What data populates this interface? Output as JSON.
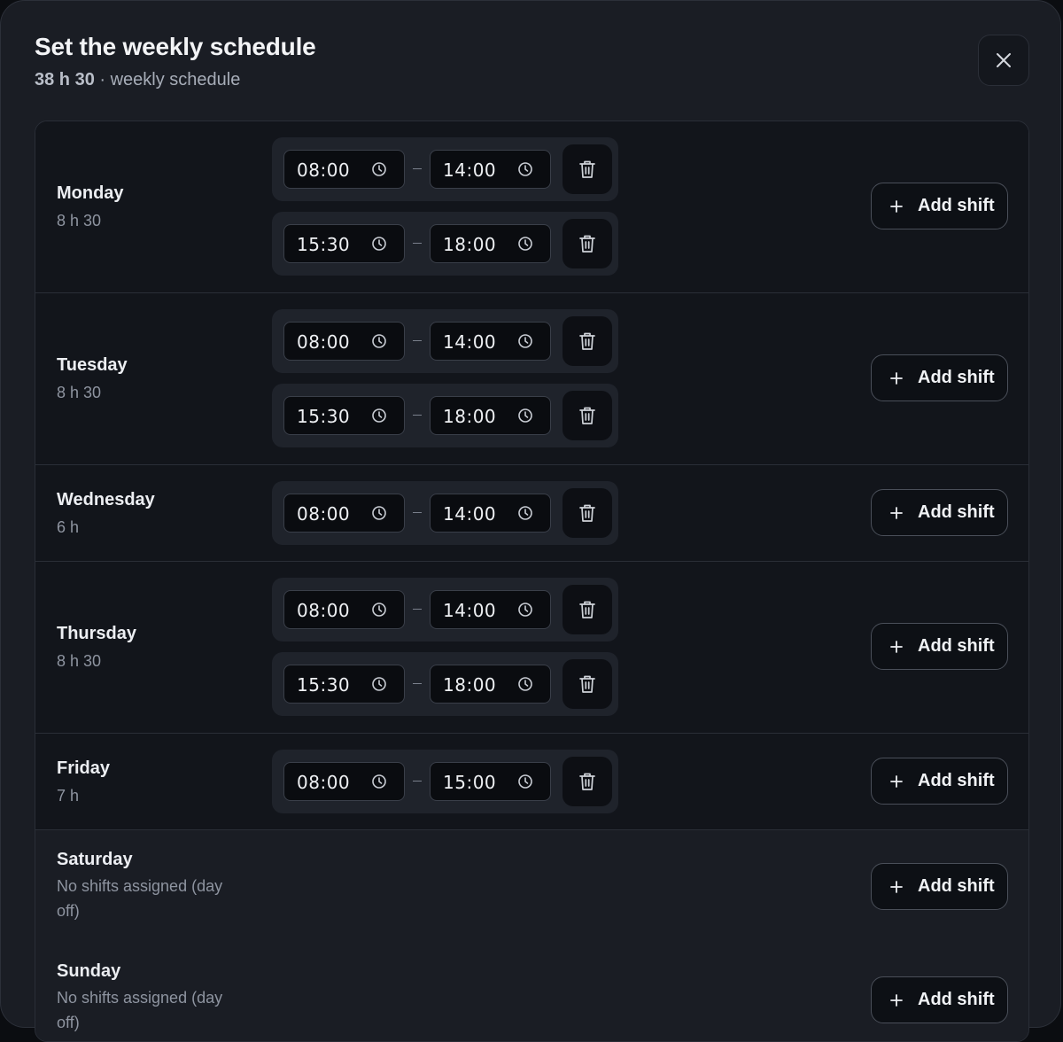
{
  "header": {
    "title": "Set the weekly schedule",
    "total": "38 h 30",
    "subtitle_rest": " · weekly schedule"
  },
  "add_label": "Add shift",
  "days": [
    {
      "name": "Monday",
      "total": "8 h 30",
      "shifts": [
        {
          "start": "08:00",
          "end": "14:00"
        },
        {
          "start": "15:30",
          "end": "18:00"
        }
      ]
    },
    {
      "name": "Tuesday",
      "total": "8 h 30",
      "shifts": [
        {
          "start": "08:00",
          "end": "14:00"
        },
        {
          "start": "15:30",
          "end": "18:00"
        }
      ]
    },
    {
      "name": "Wednesday",
      "total": "6 h",
      "shifts": [
        {
          "start": "08:00",
          "end": "14:00"
        }
      ]
    },
    {
      "name": "Thursday",
      "total": "8 h 30",
      "shifts": [
        {
          "start": "08:00",
          "end": "14:00"
        },
        {
          "start": "15:30",
          "end": "18:00"
        }
      ]
    },
    {
      "name": "Friday",
      "total": "7 h",
      "shifts": [
        {
          "start": "08:00",
          "end": "15:00"
        }
      ]
    },
    {
      "name": "Saturday",
      "total": "No shifts assigned (day off)",
      "shifts": []
    },
    {
      "name": "Sunday",
      "total": "No shifts assigned (day off)",
      "shifts": []
    }
  ]
}
